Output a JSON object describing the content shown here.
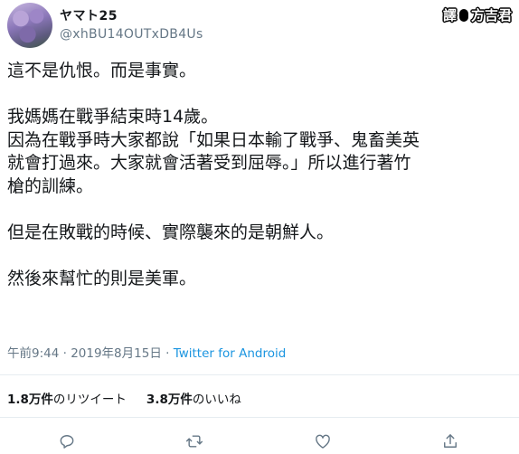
{
  "user": {
    "display_name": "ヤマト25",
    "handle": "@xhBU14OUTxDB4Us"
  },
  "watermark": {
    "left": "譯",
    "right": "方吉君"
  },
  "tweet": {
    "paragraphs": [
      "這不是仇恨。而是事實。",
      "我媽媽在戰爭結束時14歲。\n因為在戰爭時大家都說「如果日本輸了戰爭、鬼畜美英\n就會打過來。大家就會活著受到屈辱。」所以進行著竹\n槍的訓練。",
      "但是在敗戰的時候、實際襲來的是朝鮮人。",
      "然後來幫忙的則是美軍。"
    ],
    "timestamp": "午前9:44 · 2019年8月15日 · ",
    "source": "Twitter for Android"
  },
  "stats": {
    "retweets_count": "1.8万件",
    "retweets_label": "のリツイート",
    "likes_count": "3.8万件",
    "likes_label": "のいいね"
  },
  "colors": {
    "text": "#14171a",
    "secondary": "#657786",
    "link": "#1b95e0",
    "divider": "#e6ecf0"
  },
  "icons": [
    "reply-icon",
    "retweet-icon",
    "like-icon",
    "share-icon"
  ]
}
